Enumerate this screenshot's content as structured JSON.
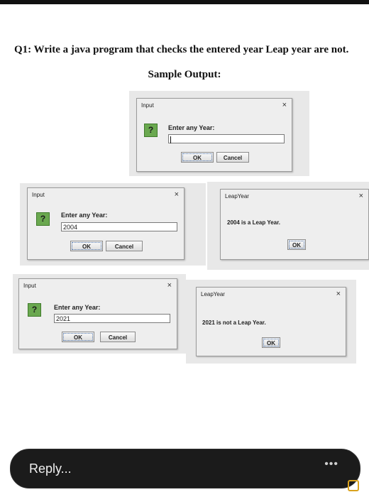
{
  "question": "Q1: Write a java program that checks the entered year Leap year are not.",
  "sample_heading": "Sample Output:",
  "dialogs": {
    "input1": {
      "title": "Input",
      "prompt": "Enter any Year:",
      "value": "",
      "ok": "OK",
      "cancel": "Cancel"
    },
    "input2": {
      "title": "Input",
      "prompt": "Enter any Year:",
      "value": "2004",
      "ok": "OK",
      "cancel": "Cancel"
    },
    "result1": {
      "title": "LeapYear",
      "message": "2004 is a Leap Year.",
      "ok": "OK"
    },
    "input3": {
      "title": "Input",
      "prompt": "Enter any Year:",
      "value": "2021",
      "ok": "OK",
      "cancel": "Cancel"
    },
    "result2": {
      "title": "LeapYear",
      "message": "2021 is not a Leap Year.",
      "ok": "OK"
    }
  },
  "close_glyph": "×",
  "question_glyph": "?",
  "reply": {
    "placeholder": "Reply...",
    "more": "•••"
  },
  "colors": {
    "icon_green": "#6aa84f",
    "reply_bg": "#1b1b1b"
  }
}
